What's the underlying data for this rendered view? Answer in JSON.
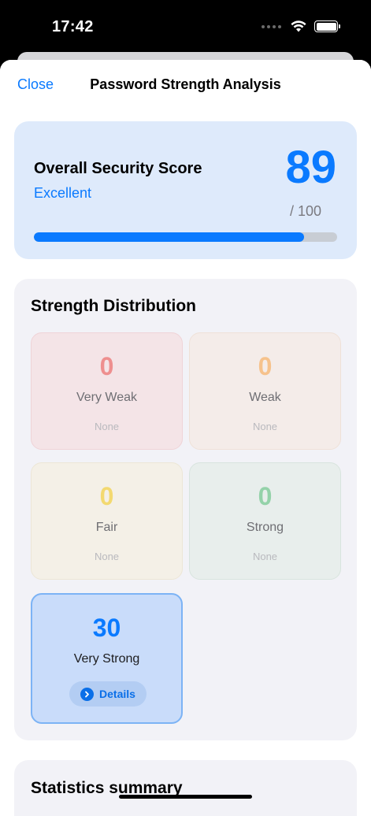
{
  "status_bar": {
    "time": "17:42"
  },
  "nav": {
    "close_label": "Close",
    "title": "Password Strength Analysis"
  },
  "score": {
    "heading": "Overall Security Score",
    "rating": "Excellent",
    "value": "89",
    "max": "/ 100",
    "progress_fraction": 0.89,
    "accent_color": "#0a7aff"
  },
  "distribution": {
    "title": "Strength Distribution",
    "tiles": [
      {
        "count": "0",
        "label": "Very Weak",
        "sub": "None",
        "color": "#ee8f8f"
      },
      {
        "count": "0",
        "label": "Weak",
        "sub": "None",
        "color": "#f6c28c"
      },
      {
        "count": "0",
        "label": "Fair",
        "sub": "None",
        "color": "#f3d970"
      },
      {
        "count": "0",
        "label": "Strong",
        "sub": "None",
        "color": "#94d2a9"
      },
      {
        "count": "30",
        "label": "Very Strong",
        "details_label": "Details",
        "color": "#0a7aff"
      }
    ]
  },
  "stats": {
    "title": "Statistics summary"
  }
}
